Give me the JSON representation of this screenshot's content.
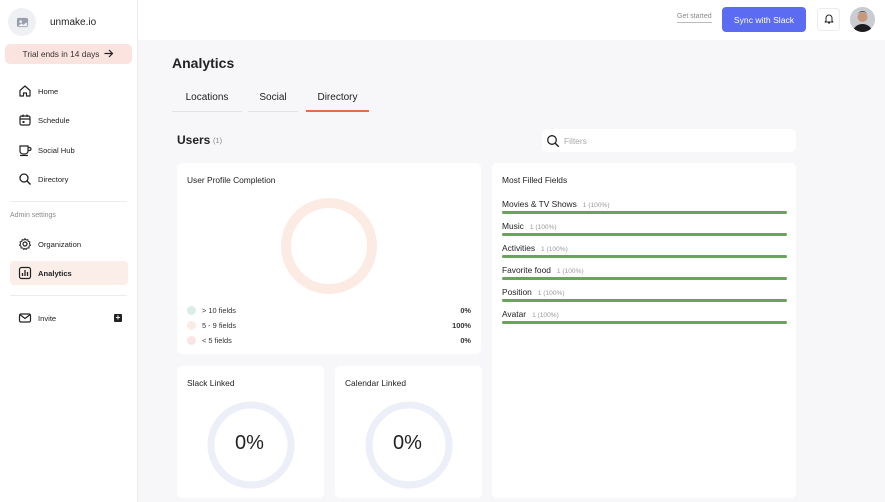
{
  "brand": {
    "name": "unmake.io"
  },
  "trial": {
    "label": "Trial ends in 14 days"
  },
  "sidebar": {
    "items": [
      {
        "label": "Home"
      },
      {
        "label": "Schedule"
      },
      {
        "label": "Social Hub"
      },
      {
        "label": "Directory"
      }
    ],
    "admin_section": "Admin settings",
    "admin_items": [
      {
        "label": "Organization"
      },
      {
        "label": "Analytics"
      }
    ],
    "invite": {
      "label": "Invite"
    }
  },
  "topbar": {
    "get_started": "Get started",
    "sync_button": "Sync with Slack"
  },
  "page": {
    "title": "Analytics",
    "tabs": [
      {
        "label": "Locations"
      },
      {
        "label": "Social"
      },
      {
        "label": "Directory",
        "active": true
      }
    ]
  },
  "users": {
    "title": "Users",
    "count": "(1)",
    "filter_placeholder": "Filters"
  },
  "profile_completion": {
    "title": "User Profile Completion",
    "legend": [
      {
        "label": "> 10 fields",
        "value": "0%",
        "color": "#d8efe9",
        "fraction": 0
      },
      {
        "label": "5 - 9 fields",
        "value": "100%",
        "color": "#fcebe3",
        "fraction": 1
      },
      {
        "label": "< 5 fields",
        "value": "0%",
        "color": "#fbe4e6",
        "fraction": 0
      }
    ]
  },
  "most_filled": {
    "title": "Most Filled Fields",
    "fields": [
      {
        "label": "Movies & TV Shows",
        "count": "1 (100%)",
        "fraction": 1
      },
      {
        "label": "Music",
        "count": "1 (100%)",
        "fraction": 1
      },
      {
        "label": "Activities",
        "count": "1 (100%)",
        "fraction": 1
      },
      {
        "label": "Favorite food",
        "count": "1 (100%)",
        "fraction": 1
      },
      {
        "label": "Position",
        "count": "1 (100%)",
        "fraction": 1
      },
      {
        "label": "Avatar",
        "count": "1 (100%)",
        "fraction": 1
      }
    ]
  },
  "slack_linked": {
    "title": "Slack Linked",
    "value": "0%"
  },
  "calendar_linked": {
    "title": "Calendar Linked",
    "value": "0%"
  },
  "colors": {
    "accent": "#5b6cf2",
    "tab_active": "#e36d50",
    "bar_fill": "#6aa35b",
    "active_nav_bg": "#fbeee9",
    "trial_bg": "#fbe4e0"
  }
}
